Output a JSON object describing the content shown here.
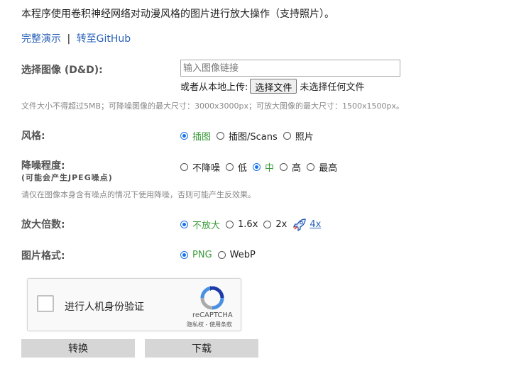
{
  "intro": "本程序使用卷积神经网络对动漫风格的图片进行放大操作（支持照片）。",
  "links": {
    "demo": "完整演示",
    "separator": "|",
    "github": "转至GitHub"
  },
  "image": {
    "label": "选择图像 (D&D):",
    "url_placeholder": "输入图像链接",
    "url_value": "",
    "upload_prefix": "或者从本地上传:",
    "choose_file_button": "选择文件",
    "file_status": "未选择任何文件",
    "limits_note": "文件大小不得超过5MB；可降噪图像的最大尺寸：3000x3000px；可放大图像的最大尺寸：1500x1500px。"
  },
  "style": {
    "label": "风格:",
    "options": [
      {
        "label": "插图",
        "checked": true
      },
      {
        "label": "插图/Scans",
        "checked": false
      },
      {
        "label": "照片",
        "checked": false
      }
    ]
  },
  "noise": {
    "label": "降噪程度:",
    "sublabel": "(可能会产生JPEG噪点)",
    "options": [
      {
        "label": "不降噪",
        "checked": false
      },
      {
        "label": "低",
        "checked": false
      },
      {
        "label": "中",
        "checked": true
      },
      {
        "label": "高",
        "checked": false
      },
      {
        "label": "最高",
        "checked": false
      }
    ],
    "note": "请仅在图像本身含有噪点的情况下使用降噪，否则可能产生反效果。"
  },
  "scale": {
    "label": "放大倍数:",
    "options": [
      {
        "label": "不放大",
        "checked": true
      },
      {
        "label": "1.6x",
        "checked": false
      },
      {
        "label": "2x",
        "checked": false
      }
    ],
    "extra_link": "4x",
    "extra_icon": "rocket-icon"
  },
  "format": {
    "label": "图片格式:",
    "options": [
      {
        "label": "PNG",
        "checked": true
      },
      {
        "label": "WebP",
        "checked": false
      }
    ]
  },
  "captcha": {
    "label": "进行人机身份验证",
    "brand": "reCAPTCHA",
    "terms": "隐私权 - 使用条款"
  },
  "actions": {
    "convert": "转换",
    "download": "下载"
  },
  "colors": {
    "link": "#2a62b8",
    "selected_option": "#3a9a3a",
    "radio_accent": "#1a73e8",
    "button_bg": "#d6d6d6"
  }
}
